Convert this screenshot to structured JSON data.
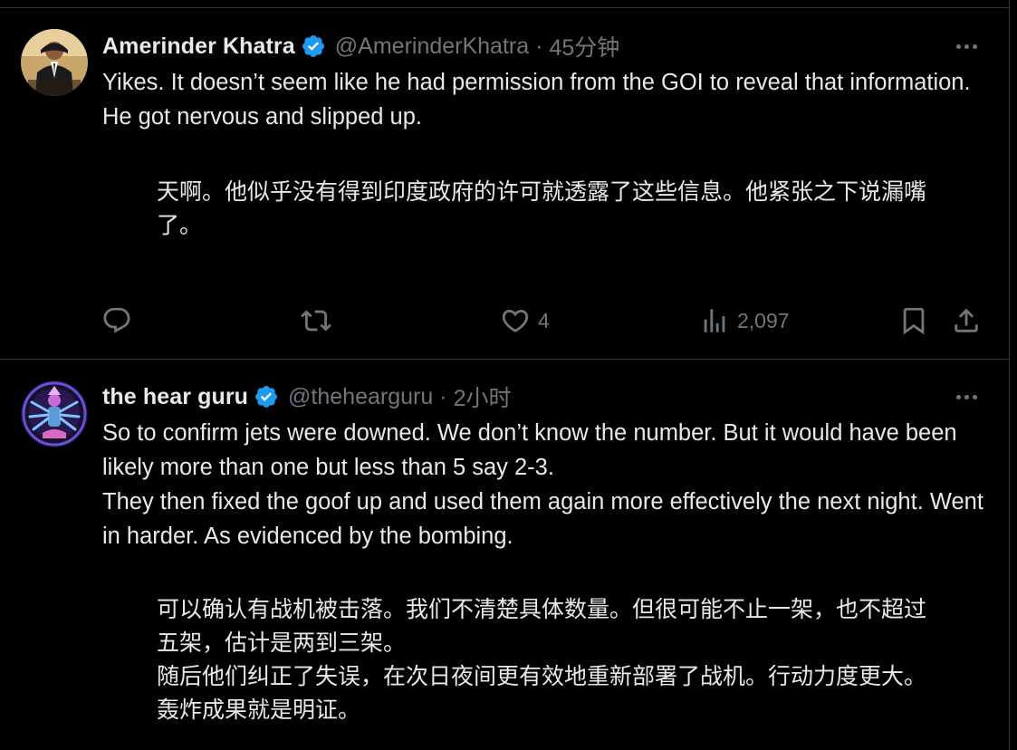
{
  "tweets": [
    {
      "author_name": "Amerinder Khatra",
      "handle": "@AmerinderKhatra",
      "separator": "·",
      "time": "45分钟",
      "body": [
        "Yikes. It doesn’t seem like he had permission from the GOI to reveal that information. He got nervous and slipped up."
      ],
      "translation": [
        "天啊。他似乎没有得到印度政府的许可就透露了这些信息。他紧张之下说漏嘴了。"
      ],
      "stats": {
        "likes": "4",
        "views": "2,097"
      }
    },
    {
      "author_name": "the hear guru",
      "handle": "@thehearguru",
      "separator": "·",
      "time": "2小时",
      "body": [
        "So to confirm jets were downed.  We don’t know the number.  But it would have been likely more than one but less than 5 say 2-3.",
        "They then fixed the goof up and used them again more effectively the next night. Went in harder. As evidenced by the bombing."
      ],
      "translation": [
        "可以确认有战机被击落。我们不清楚具体数量。但很可能不止一架，也不超过五架，估计是两到三架。",
        "随后他们纠正了失误，在次日夜间更有效地重新部署了战机。行动力度更大。轰炸成果就是明证。"
      ]
    }
  ],
  "icons": {
    "verified": "verified-badge-icon",
    "more": "more-icon",
    "reply": "reply-icon",
    "retweet": "retweet-icon",
    "like": "like-icon",
    "views": "views-icon",
    "bookmark": "bookmark-icon",
    "share": "share-icon"
  },
  "colors": {
    "background": "#000000",
    "text": "#e7e9ea",
    "secondary": "#71767b",
    "verified": "#1d9bf0",
    "divider": "#2f3336"
  }
}
